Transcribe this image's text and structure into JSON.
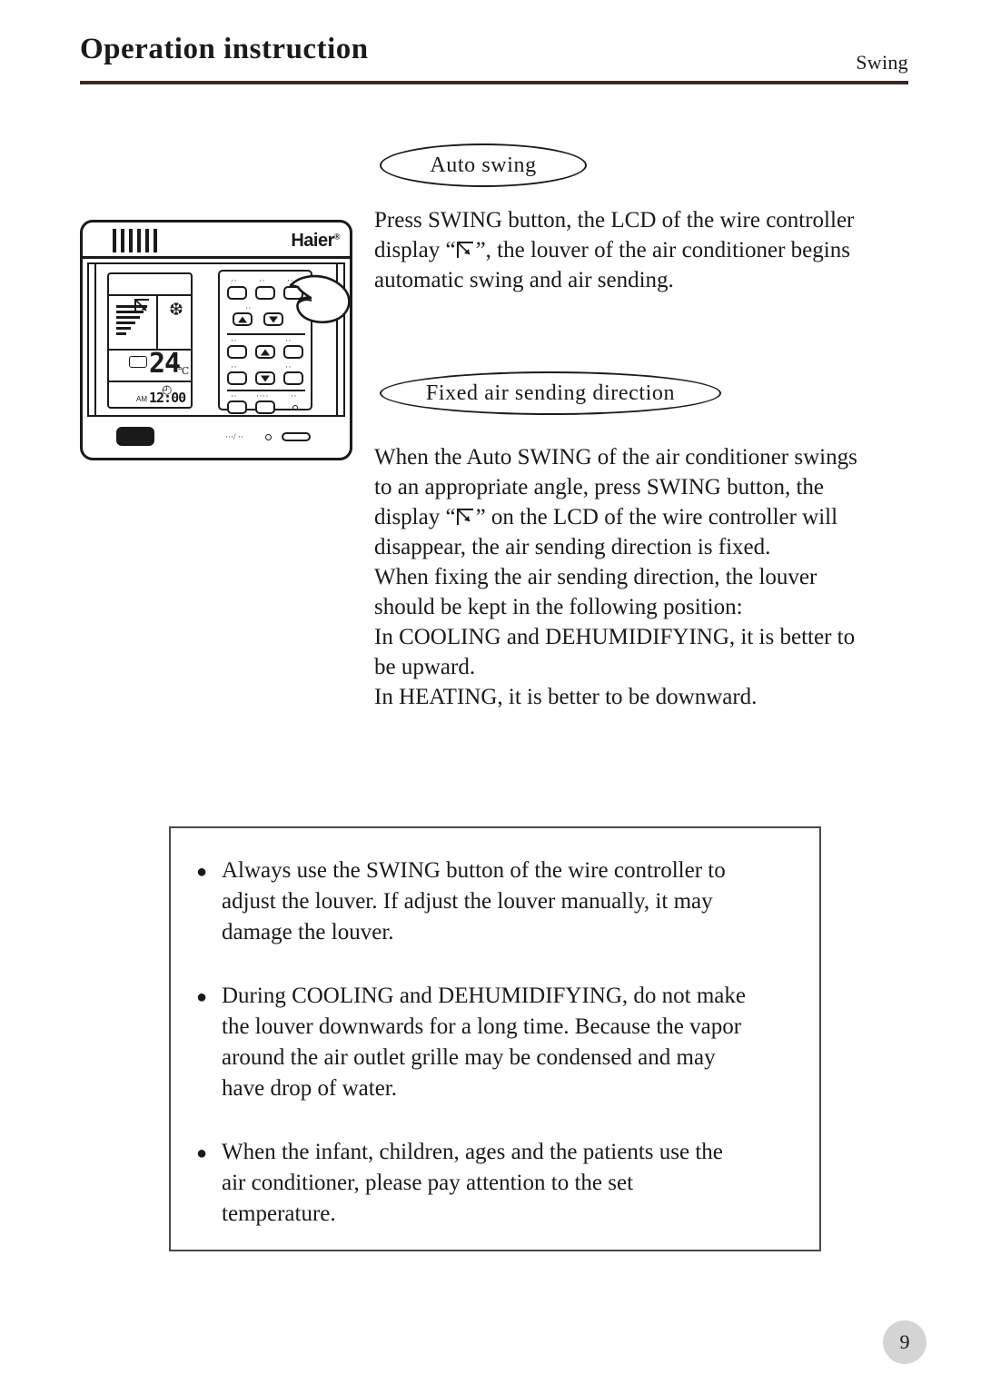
{
  "header": {
    "title": "Operation instruction",
    "section": "Swing"
  },
  "sections": [
    {
      "caption": "Auto swing",
      "lines_before_glyph": "Press SWING button, the LCD of the wire controller",
      "line2_a": "display “",
      "line2_b": "”, the louver of the air conditioner begins",
      "line3": "automatic swing and air sending."
    },
    {
      "caption": "Fixed air sending direction",
      "line1": "When the Auto SWING of the air conditioner swings",
      "line2": "to an appropriate angle, press SWING button, the",
      "line3_a": "display “",
      "line3_b": "” on the LCD of the wire controller will",
      "line4": "disappear, the air sending direction is fixed.",
      "line5": "When fixing the air sending direction, the louver",
      "line6": "should be kept in the following position:",
      "line7": "In COOLING and DEHUMIDIFYING, it is better to",
      "line8": "be upward.",
      "line9": "In HEATING, it is better to be downward."
    }
  ],
  "controller": {
    "brand": "Haier",
    "brand_mark": "®",
    "lcd": {
      "temperature": "24",
      "temperature_unit": "℃",
      "ampm": "AM",
      "time": "12:00",
      "mode_icon": "snowflake-icon",
      "mode_glyph": "❆",
      "clock_glyph": "◴",
      "swing_icon": "swing-icon",
      "fan_icon": "fan-speed-icon",
      "set_label": "··"
    },
    "buttons": {
      "dots_small": "··",
      "dots_large": "····"
    },
    "bottom_marks": "···/ ··"
  },
  "notices": {
    "bullet": "●",
    "items": [
      {
        "lines": [
          "Always use the SWING button of the wire controller to",
          "adjust the louver. If adjust the louver manually, it may",
          "damage the louver."
        ]
      },
      {
        "lines": [
          "During COOLING and DEHUMIDIFYING, do not make",
          " the louver downwards for a long time. Because the vapor",
          "around the air outlet grille may be condensed and may",
          "have drop of water."
        ]
      },
      {
        "lines": [
          "When the infant, children, ages and the patients use the",
          "air conditioner, please pay attention to the set",
          "temperature."
        ]
      }
    ]
  },
  "page_number": "9"
}
